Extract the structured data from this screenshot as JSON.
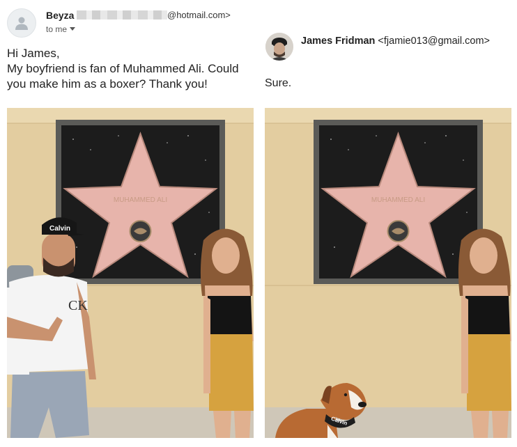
{
  "original_email": {
    "sender_name": "Beyza",
    "sender_email_suffix": "@hotmail.com>",
    "recipient_label": "to me",
    "greeting": "Hi James,",
    "body_line1": "My boyfriend is fan of Muhammed Ali. Could",
    "body_line2": "you make him as a boxer? Thank you!"
  },
  "reply_email": {
    "sender_name": "James Fridman",
    "sender_email": "<fjamie013@gmail.com>",
    "body": "Sure."
  },
  "photos": {
    "cap_text": "Calvin",
    "collar_text": "Calvin",
    "star_text": "MUHAMMED ALI"
  },
  "colors": {
    "wall": "#e3cda0",
    "plaque_frame": "#5b5b58",
    "plaque_fill": "#1c1c1c",
    "star_pink": "#e7b4ab",
    "shirt_white": "#f4f4f4",
    "shorts_grey": "#9aa6b6",
    "skirt_mustard": "#d6a23f",
    "dog_brown": "#b86a33"
  },
  "icons": {
    "avatar": "person-icon",
    "dropdown": "chevron-down-icon"
  }
}
